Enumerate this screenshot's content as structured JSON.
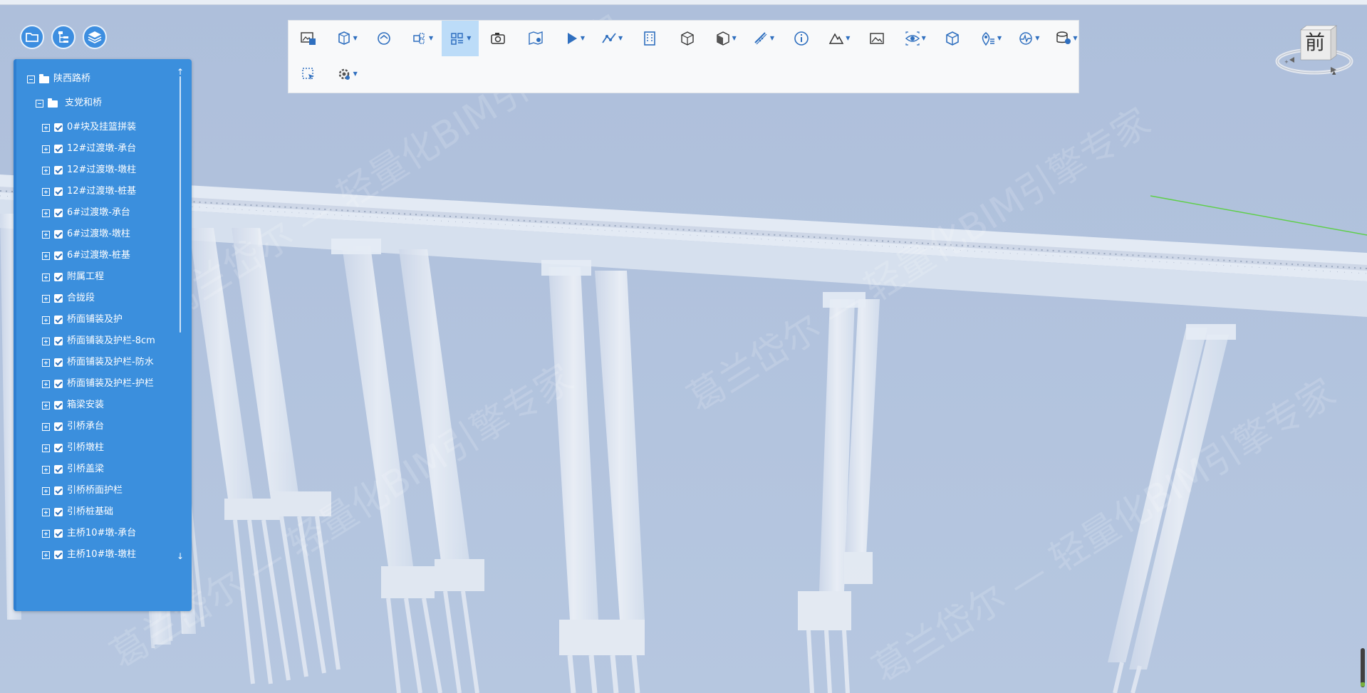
{
  "side_buttons": [
    {
      "name": "folder-button",
      "icon": "folder-icon"
    },
    {
      "name": "tree-button",
      "icon": "tree-structure-icon"
    },
    {
      "name": "layers-button",
      "icon": "layers-icon"
    }
  ],
  "tree": {
    "root": "陕西路桥",
    "project": "支党和桥",
    "items": [
      "0#块及挂篮拼装",
      "12#过渡墩-承台",
      "12#过渡墩-墩柱",
      "12#过渡墩-桩基",
      "6#过渡墩-承台",
      "6#过渡墩-墩柱",
      "6#过渡墩-桩基",
      "附属工程",
      "合拢段",
      "桥面铺装及护",
      "桥面铺装及护栏-8cm",
      "桥面铺装及护栏-防水",
      "桥面铺装及护栏-护栏",
      "箱梁安装",
      "引桥承台",
      "引桥墩柱",
      "引桥盖梁",
      "引桥桥面护栏",
      "引桥桩基础",
      "主桥10#墩-承台",
      "主桥10#墩-墩柱"
    ]
  },
  "toolbar": {
    "tools": [
      {
        "icon": "image-save-icon",
        "dropdown": false
      },
      {
        "icon": "box-section-icon",
        "dropdown": true
      },
      {
        "icon": "roam-icon",
        "dropdown": false
      },
      {
        "icon": "explode-icon",
        "dropdown": true
      },
      {
        "icon": "grid-list-icon",
        "dropdown": true,
        "active": true
      },
      {
        "icon": "camera-icon",
        "dropdown": false
      },
      {
        "icon": "map-settings-icon",
        "dropdown": false
      },
      {
        "icon": "play-icon",
        "dropdown": true
      },
      {
        "icon": "path-icon",
        "dropdown": true
      },
      {
        "icon": "building-icon",
        "dropdown": false
      },
      {
        "icon": "cube-icon",
        "dropdown": false
      },
      {
        "icon": "material-icon",
        "dropdown": true
      },
      {
        "icon": "measure-icon",
        "dropdown": true
      },
      {
        "icon": "info-icon",
        "dropdown": false
      },
      {
        "icon": "terrain-icon",
        "dropdown": true
      },
      {
        "icon": "picture-icon",
        "dropdown": false
      },
      {
        "icon": "eye-view-icon",
        "dropdown": true
      },
      {
        "icon": "model-box-icon",
        "dropdown": false
      },
      {
        "icon": "location-list-icon",
        "dropdown": true
      },
      {
        "icon": "monitor-icon",
        "dropdown": true
      },
      {
        "icon": "database-settings-icon",
        "dropdown": true
      },
      {
        "icon": "select-box-icon",
        "dropdown": false
      },
      {
        "icon": "settings-icon",
        "dropdown": true
      }
    ]
  },
  "view_cube": {
    "face": "前"
  },
  "watermark": "葛兰岱尔 — 轻量化BIM引擎专家",
  "colors": {
    "panel": "#3b8fdd",
    "accent": "#3d8ee0",
    "background": "#b3c4de"
  }
}
